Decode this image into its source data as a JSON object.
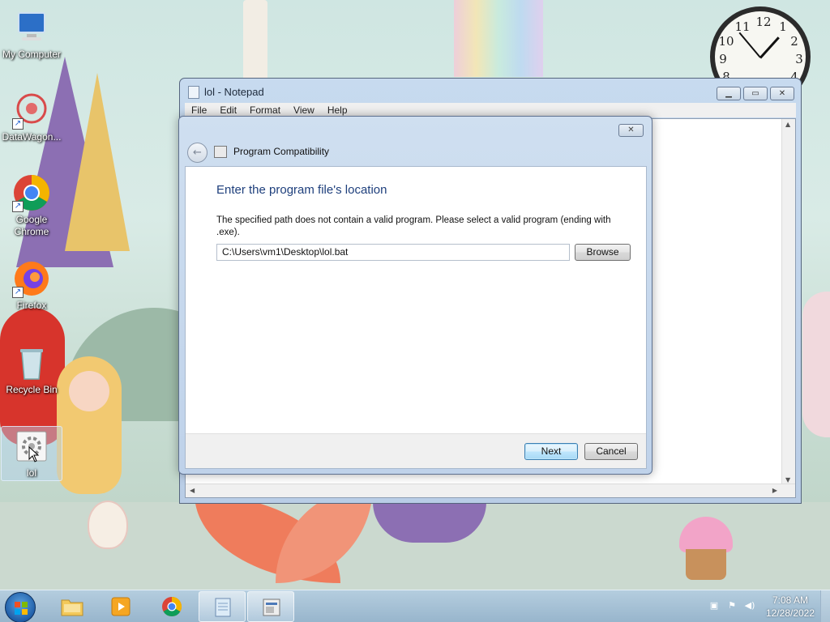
{
  "desktop": {
    "icons": [
      {
        "label": "My Computer"
      },
      {
        "label": "DataWagon..."
      },
      {
        "label": "Google Chrome"
      },
      {
        "label": "Firefox"
      },
      {
        "label": "Recycle Bin"
      },
      {
        "label": "lol"
      }
    ]
  },
  "clock": {
    "numbers": [
      "12",
      "1",
      "2",
      "3",
      "4",
      "8",
      "9",
      "10",
      "11"
    ]
  },
  "notepad": {
    "title": "lol - Notepad",
    "menu": [
      "File",
      "Edit",
      "Format",
      "View",
      "Help"
    ],
    "controls": {
      "minimize": "▁",
      "maximize": "▭",
      "close": "✕"
    }
  },
  "dialog": {
    "app_title": "Program Compatibility",
    "heading": "Enter the program file's location",
    "message": "The specified path does not contain a valid program.  Please select a valid program (ending with .exe).",
    "path_value": "C:\\Users\\vm1\\Desktop\\lol.bat",
    "browse_label": "Browse",
    "next_label": "Next",
    "cancel_label": "Cancel",
    "close_glyph": "✕",
    "back_glyph": "←"
  },
  "taskbar": {
    "time": "7:08 AM",
    "date": "12/28/2022",
    "tray_icons": [
      "network-icon",
      "action-center-icon",
      "volume-icon"
    ],
    "pinned": [
      "windows-explorer-icon",
      "media-player-icon",
      "chrome-icon",
      "notepad-icon",
      "program-compatibility-icon"
    ]
  },
  "colors": {
    "heading_blue": "#1e3f7c",
    "window_frame": "#c7daef",
    "taskbar": "#9ab6cf"
  }
}
